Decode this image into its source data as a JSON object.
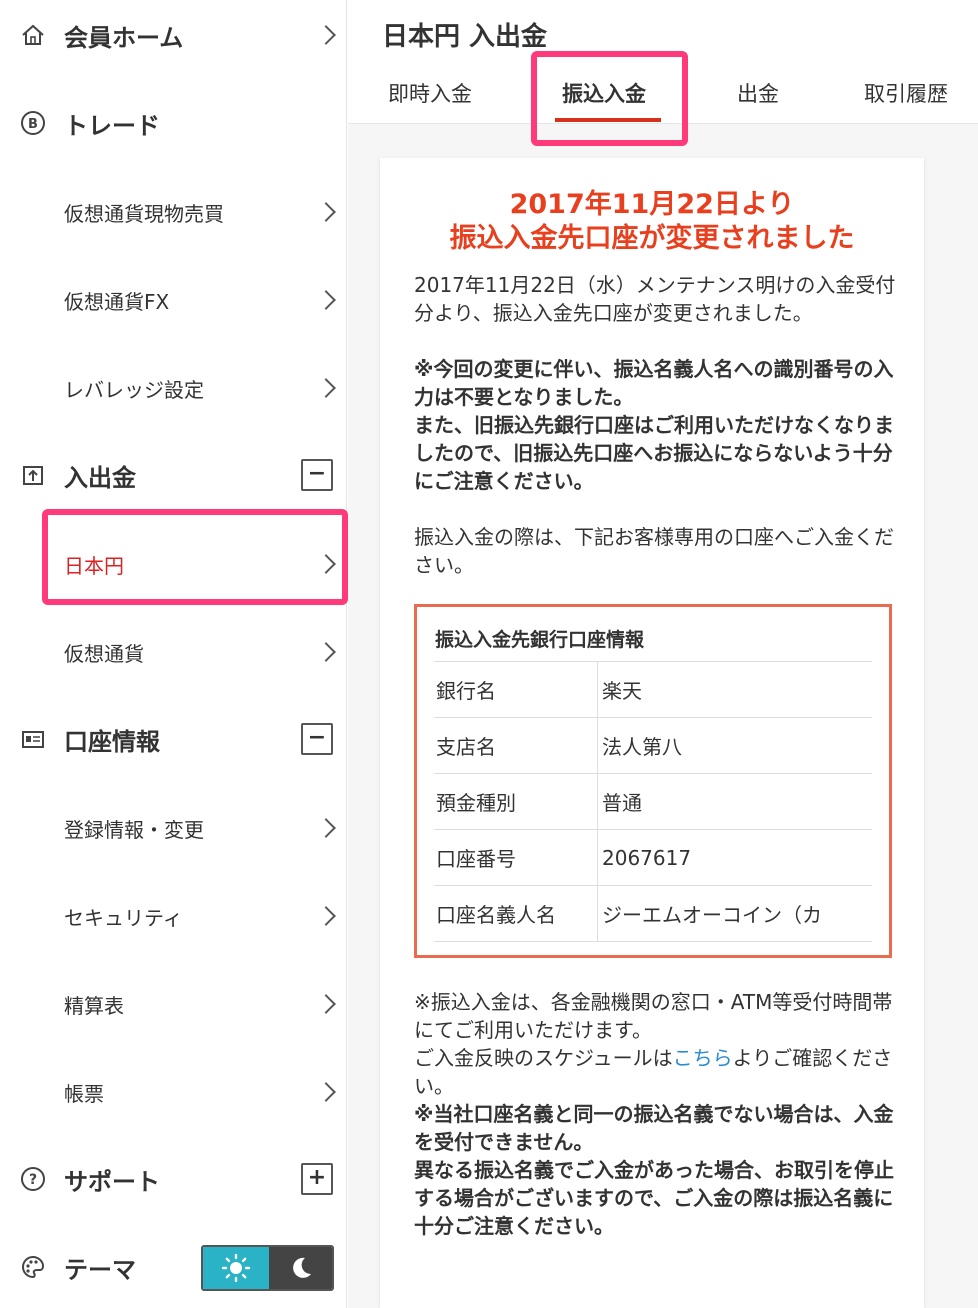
{
  "sidebar": {
    "home": "会員ホーム",
    "trade": "トレード",
    "trade_items": [
      "仮想通貨現物売買",
      "仮想通貨FX",
      "レバレッジ設定"
    ],
    "deposit": "入出金",
    "deposit_items": [
      "日本円",
      "仮想通貨"
    ],
    "account": "口座情報",
    "account_items": [
      "登録情報・変更",
      "セキュリティ",
      "精算表",
      "帳票"
    ],
    "support": "サポート",
    "theme": "テーマ",
    "minus": "−",
    "plus": "+"
  },
  "main": {
    "title": "日本円 入出金",
    "tabs": [
      "即時入金",
      "振込入金",
      "出金",
      "取引履歴"
    ],
    "notice_title_1": "2017年11月22日より",
    "notice_title_2": "振込入金先口座が変更されました",
    "para1": "2017年11月22日（水）メンテナンス明けの入金受付分より、振込入金先口座が変更されました。",
    "para1_bold": "※今回の変更に伴い、振込名義人名への識別番号の入力は不要となりました。\nまた、旧振込先銀行口座はご利用いただけなくなりましたので、旧振込先口座へお振込にならないよう十分にご注意ください。",
    "para2": "振込入金の際は、下記お客様専用の口座へご入金ください。",
    "bank_title": "振込入金先銀行口座情報",
    "bank_rows": [
      {
        "k": "銀行名",
        "v": "楽天"
      },
      {
        "k": "支店名",
        "v": "法人第八"
      },
      {
        "k": "預金種別",
        "v": "普通"
      },
      {
        "k": "口座番号",
        "v": "2067617"
      },
      {
        "k": "口座名義人名",
        "v": "ジーエムオーコイン（カ"
      }
    ],
    "footer_1": "※振込入金は、各金融機関の窓口・ATM等受付時間帯にてご利用いただけます。",
    "footer_2a": "ご入金反映のスケジュールは",
    "footer_2link": "こちら",
    "footer_2b": "よりご確認ください。",
    "footer_bold": "※当社口座名義と同一の振込名義でない場合は、入金を受付できません。\n異なる振込名義でご入金があった場合、お取引を停止する場合がございますので、ご入金の際は振込名義に十分ご注意ください。"
  }
}
